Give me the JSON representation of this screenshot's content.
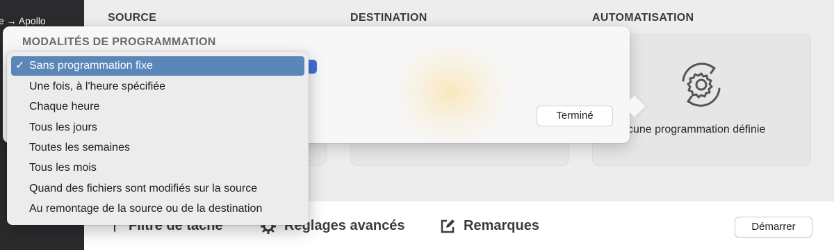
{
  "sidebar": {
    "item_label": "e → Apollo"
  },
  "columns": {
    "source_header": "SOURCE",
    "destination_header": "DESTINATION",
    "automation_header": "AUTOMATISATION",
    "automation_card_text": "cune programmation définie",
    "automation_icon": "gear-cycle-icon"
  },
  "popover": {
    "title": "MODALITÉS DE PROGRAMMATION",
    "done_label": "Terminé"
  },
  "menu": {
    "items": [
      {
        "label": "Sans programmation fixe",
        "check": "✓"
      },
      {
        "label": "Une fois, à l'heure spécifiée",
        "check": ""
      },
      {
        "label": "Chaque heure",
        "check": ""
      },
      {
        "label": "Tous les jours",
        "check": ""
      },
      {
        "label": "Toutes les semaines",
        "check": ""
      },
      {
        "label": "Tous les mois",
        "check": ""
      },
      {
        "label": "Quand des fichiers sont modifiés sur la source",
        "check": ""
      },
      {
        "label": "Au remontage de la source ou de la destination",
        "check": ""
      }
    ]
  },
  "bottom": {
    "filter_label": "Filtre de tâche",
    "settings_label": "Réglages avancés",
    "notes_label": "Remarques",
    "start_label": "Démarrer"
  },
  "colors": {
    "menu_selected": "#5a86b8",
    "sidebar": "#2b2b2e"
  }
}
